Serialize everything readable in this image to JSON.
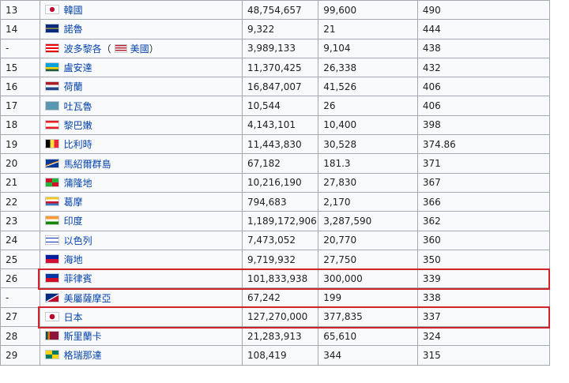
{
  "rows": [
    {
      "rank": "13",
      "name": "韓國",
      "flag": "kr-flag-icon",
      "population": "48,754,657",
      "area": "99,600",
      "density": "490"
    },
    {
      "rank": "14",
      "name": "諾魯",
      "flag": "nr-flag-icon",
      "population": "9,322",
      "area": "21",
      "density": "444"
    },
    {
      "rank": "-",
      "name": "波多黎各",
      "flag": "pr-flag-icon",
      "sub": "美國",
      "sub_flag": "us-flag-icon",
      "population": "3,989,133",
      "area": "9,104",
      "density": "438"
    },
    {
      "rank": "15",
      "name": "盧安達",
      "flag": "rw-flag-icon",
      "population": "11,370,425",
      "area": "26,338",
      "density": "432"
    },
    {
      "rank": "16",
      "name": "荷蘭",
      "flag": "nl-flag-icon",
      "population": "16,847,007",
      "area": "41,526",
      "density": "406"
    },
    {
      "rank": "17",
      "name": "吐瓦魯",
      "flag": "tv-flag-icon",
      "population": "10,544",
      "area": "26",
      "density": "406"
    },
    {
      "rank": "18",
      "name": "黎巴嫩",
      "flag": "lb-flag-icon",
      "population": "4,143,101",
      "area": "10,400",
      "density": "398"
    },
    {
      "rank": "19",
      "name": "比利時",
      "flag": "be-flag-icon",
      "population": "11,443,830",
      "area": "30,528",
      "density": "374.86"
    },
    {
      "rank": "20",
      "name": "馬紹爾群島",
      "flag": "mh-flag-icon",
      "population": "67,182",
      "area": "181.3",
      "density": "371"
    },
    {
      "rank": "21",
      "name": "蒲隆地",
      "flag": "bi-flag-icon",
      "population": "10,216,190",
      "area": "27,830",
      "density": "367"
    },
    {
      "rank": "22",
      "name": "葛摩",
      "flag": "km-flag-icon",
      "population": "794,683",
      "area": "2,170",
      "density": "366"
    },
    {
      "rank": "23",
      "name": "印度",
      "flag": "in-flag-icon",
      "population": "1,189,172,906",
      "area": "3,287,590",
      "density": "362"
    },
    {
      "rank": "24",
      "name": "以色列",
      "flag": "il-flag-icon",
      "population": "7,473,052",
      "area": "20,770",
      "density": "360"
    },
    {
      "rank": "25",
      "name": "海地",
      "flag": "ht-flag-icon",
      "population": "9,719,932",
      "area": "27,750",
      "density": "350"
    },
    {
      "rank": "26",
      "name": "菲律賓",
      "flag": "ph-flag-icon",
      "population": "101,833,938",
      "area": "300,000",
      "density": "339",
      "highlight": true
    },
    {
      "rank": "-",
      "name": "美屬薩摩亞",
      "flag": "as-flag-icon",
      "population": "67,242",
      "area": "199",
      "density": "338"
    },
    {
      "rank": "27",
      "name": "日本",
      "flag": "jp-flag-icon",
      "population": "127,270,000",
      "area": "377,835",
      "density": "337",
      "highlight": true
    },
    {
      "rank": "28",
      "name": "斯里蘭卡",
      "flag": "lk-flag-icon",
      "population": "21,283,913",
      "area": "65,610",
      "density": "324"
    },
    {
      "rank": "29",
      "name": "格瑞那達",
      "flag": "gd-flag-icon",
      "population": "108,419",
      "area": "344",
      "density": "315"
    }
  ],
  "highlight_color": "#d1232a"
}
